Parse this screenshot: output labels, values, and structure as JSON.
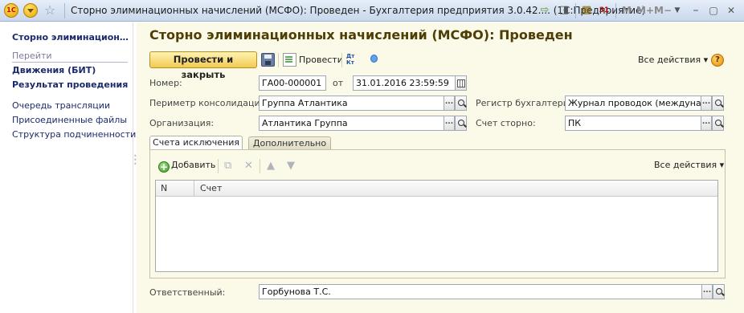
{
  "window": {
    "logo_text": "1С",
    "title": "Сторно элиминационных начислений (МСФО): Проведен - Бухгалтерия предприятия 3.0.42.... (1С:Предприятие)",
    "controls": {
      "m": "M",
      "mplus": "M+",
      "mminus": "M−",
      "restore": "▢",
      "close": "✕",
      "calc_day": "31"
    }
  },
  "sidebar": {
    "doc_link": "Сторно элиминацион…",
    "section_header": "Перейти",
    "go_items": [
      "Движения (БИТ)",
      "Результат проведения"
    ],
    "links": [
      "Очередь трансляции",
      "Присоединенные файлы",
      "Структура подчиненности"
    ]
  },
  "header": {
    "title": "Сторно элиминационных начислений (МСФО): Проведен"
  },
  "toolbar": {
    "post_close": "Провести и закрыть",
    "post": "Провести",
    "dtkt": "Дт\nКт",
    "all_actions": "Все действия",
    "help": "?"
  },
  "form": {
    "number_label": "Номер:",
    "number": "ГА00-000001",
    "date_sep": "от",
    "date": "31.01.2016 23:59:59",
    "perimeter_label": "Периметр консолидации:",
    "perimeter": "Группа Атлантика",
    "register_label": "Регистр бухгалтерии:",
    "register": "Журнал проводок (международ-",
    "org_label": "Организация:",
    "org": "Атлантика Группа",
    "storno_account_label": "Счет сторно:",
    "storno_account": "ПК",
    "responsible_label": "Ответственный:",
    "responsible": "Горбунова Т.С.",
    "choose_btn": "..."
  },
  "tabs": [
    "Счета исключения",
    "Дополнительно"
  ],
  "table": {
    "add": "Добавить",
    "all_actions": "Все действия",
    "columns": [
      "N",
      "Счет"
    ],
    "rows": []
  }
}
